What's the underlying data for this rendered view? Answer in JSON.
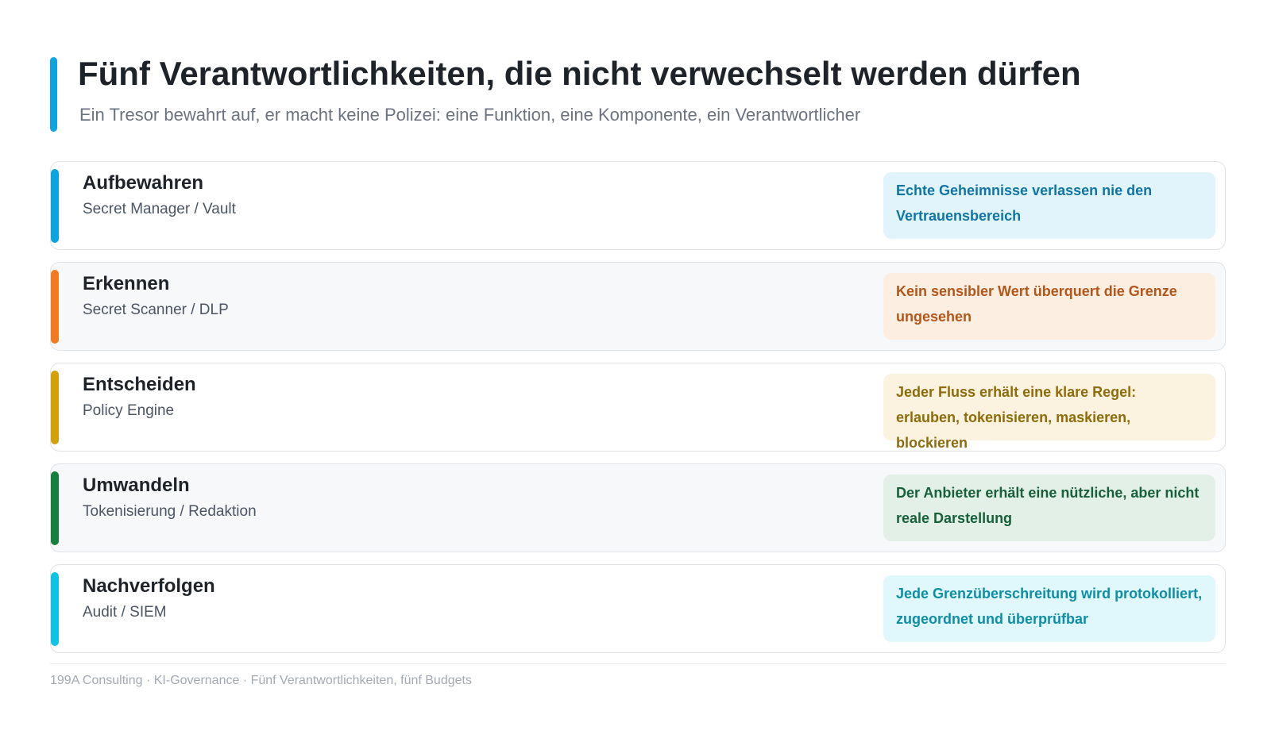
{
  "header": {
    "title": "Fünf Verantwortlichkeiten, die nicht verwechselt werden dürfen",
    "subtitle": "Ein Tresor bewahrt auf, er macht keine Polizei: eine Funktion, eine Komponente, ein Verantwortlicher",
    "accent_color": "#0aa5e0"
  },
  "roles": [
    {
      "name": "Aufbewahren",
      "component": "Secret Manager / Vault",
      "goal": "Echte Geheimnisse verlassen nie den Vertrauensbereich",
      "accent_color": "#0aa5e0",
      "goal_bg": "#e1f4fb",
      "goal_color": "#0f75a6"
    },
    {
      "name": "Erkennen",
      "component": "Secret Scanner / DLP",
      "goal": "Kein sensibler Wert überquert die Grenze ungesehen",
      "accent_color": "#f47a1f",
      "goal_bg": "#fdeee2",
      "goal_color": "#b3561a"
    },
    {
      "name": "Entscheiden",
      "component": "Policy Engine",
      "goal": "Jeder Fluss erhält eine klare Regel: erlauben, tokenisieren, maskieren, blockieren",
      "accent_color": "#d4a007",
      "goal_bg": "#fbf2df",
      "goal_color": "#8f6b09"
    },
    {
      "name": "Umwandeln",
      "component": "Tokenisierung / Redaktion",
      "goal": "Der Anbieter erhält eine nützliche, aber nicht reale Darstellung",
      "accent_color": "#15803d",
      "goal_bg": "#e3f0e7",
      "goal_color": "#17603a"
    },
    {
      "name": "Nachverfolgen",
      "component": "Audit / SIEM",
      "goal": "Jede Grenzüberschreitung wird protokolliert, zugeordnet und überprüfbar",
      "accent_color": "#0dc4e6",
      "goal_bg": "#e0f7fb",
      "goal_color": "#0e8ea6"
    }
  ],
  "footer": {
    "text": "199A Consulting · KI-Governance · Fünf Verantwortlichkeiten, fünf Budgets"
  }
}
